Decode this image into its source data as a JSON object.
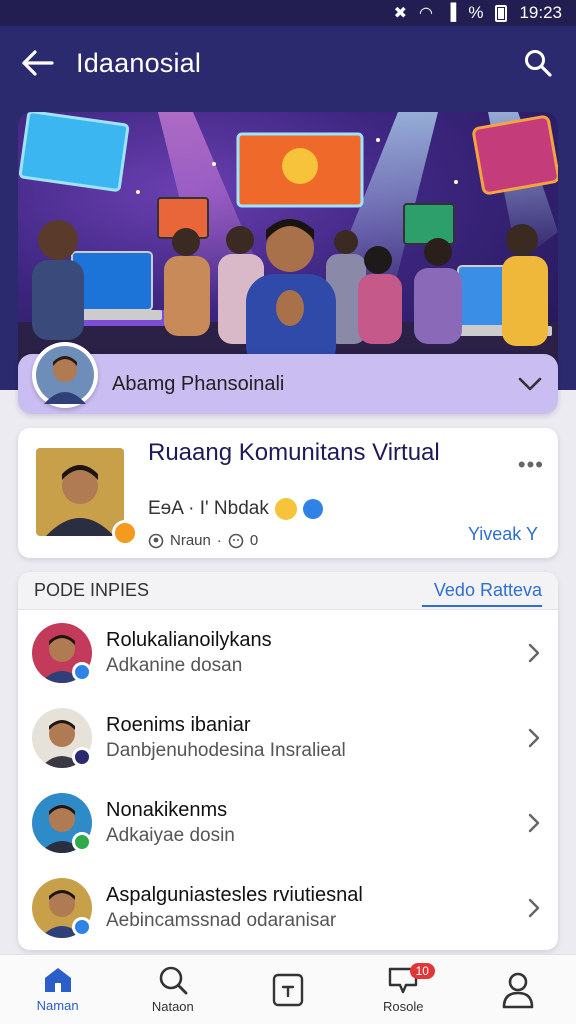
{
  "status_bar": {
    "time": "19:23",
    "battery_percent_label": "%"
  },
  "app_bar": {
    "title": "Idaanosial"
  },
  "profile_strip": {
    "name": "Abamg Phansoinali"
  },
  "group": {
    "title": "Ruaang Komunitans Virtual",
    "meta": "EɘA · I' Nbdak",
    "stats_label": "Nraun",
    "stats_count": "0",
    "view_label": "Yiveak",
    "view_suffix": "Y"
  },
  "list": {
    "section_title": "PODE INPIES",
    "section_link": "Vedo Ratteva",
    "items": [
      {
        "title": "Rolukalianoilykans",
        "subtitle": "Adkanine dosan",
        "status_color": "#2f82e6"
      },
      {
        "title": "Roenims ibaniar",
        "subtitle": "Danbjenuhodesina Insralieal",
        "status_color": "#2c2a6e"
      },
      {
        "title": "Nonakikenms",
        "subtitle": "Adkaiyae dosin",
        "status_color": "#2faa4a"
      },
      {
        "title": "Aspalguniastesles rviutiesnal",
        "subtitle": "Aebincamssnad odaranisar",
        "status_color": "#2f82e6"
      }
    ]
  },
  "bottom_nav": {
    "items": [
      {
        "label": "Naman",
        "icon": "home-icon",
        "active": true
      },
      {
        "label": "Nataon",
        "icon": "search-icon"
      },
      {
        "label": "",
        "icon": "add-post-icon"
      },
      {
        "label": "Rosole",
        "icon": "notifications-icon",
        "badge": "10"
      },
      {
        "label": "",
        "icon": "profile-icon"
      }
    ]
  },
  "colors": {
    "app_bar": "#2c2a6e",
    "accent": "#2f6fcf",
    "strip": "#c9bdf2"
  }
}
